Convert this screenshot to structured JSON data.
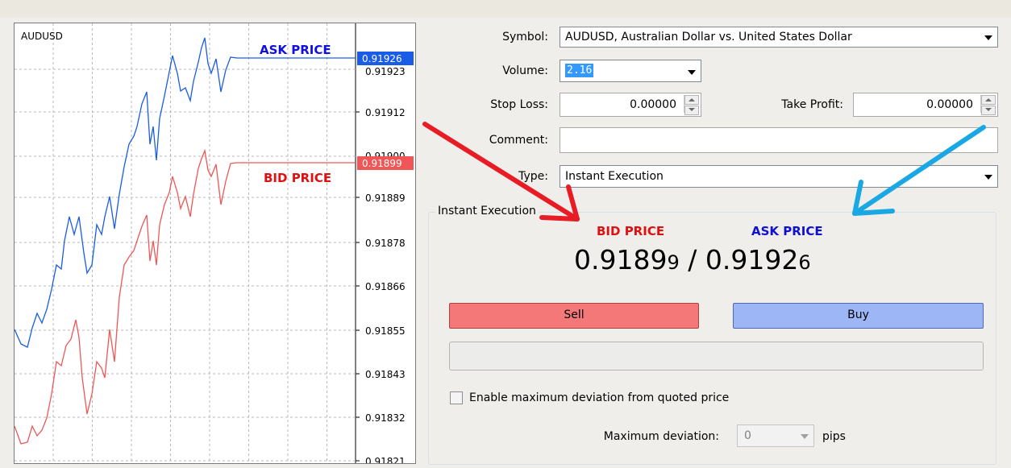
{
  "chart": {
    "symbol": "AUDUSD",
    "ask_label": "ASK PRICE",
    "bid_label": "BID PRICE",
    "ask_tag": "0.91926",
    "bid_tag": "0.91899",
    "ask_tag_hidden": "0.91923",
    "bid_tag_hidden": "0.91900",
    "price_ticks": [
      "0.91912",
      "0.91889",
      "0.91878",
      "0.91866",
      "0.91855",
      "0.91843",
      "0.91832",
      "0.91821"
    ],
    "colors": {
      "ask": "#1a5ce6",
      "bid": "#f05656",
      "ask_label": "#1010e0",
      "bid_label": "#e01010"
    }
  },
  "order": {
    "symbol_label": "Symbol:",
    "symbol_value": "AUDUSD, Australian Dollar vs. United States Dollar",
    "volume_label": "Volume:",
    "volume_value": "2.16",
    "stop_loss_label": "Stop Loss:",
    "stop_loss_value": "0.00000",
    "take_profit_label": "Take Profit:",
    "take_profit_value": "0.00000",
    "comment_label": "Comment:",
    "comment_value": "",
    "type_label": "Type:",
    "type_value": "Instant Execution"
  },
  "instant": {
    "group_title": "Instant Execution",
    "bid_label": "BID PRICE",
    "ask_label": "ASK PRICE",
    "bid_main": "0.9189",
    "bid_pip": "9",
    "separator": "/",
    "ask_main": "0.9192",
    "ask_pip": "6",
    "sell_label": "Sell",
    "buy_label": "Buy",
    "deviation_checkbox_label": "Enable maximum deviation from quoted price",
    "max_dev_label": "Maximum deviation:",
    "max_dev_value": "0",
    "pips_label": "pips",
    "colors": {
      "sell": "#f47878",
      "buy": "#9db7f6",
      "bid_label": "#e01010",
      "ask_label": "#1010d0"
    }
  },
  "annotations": {
    "red_arrow_color": "#e81c24",
    "blue_arrow_color": "#1aa8e4"
  }
}
